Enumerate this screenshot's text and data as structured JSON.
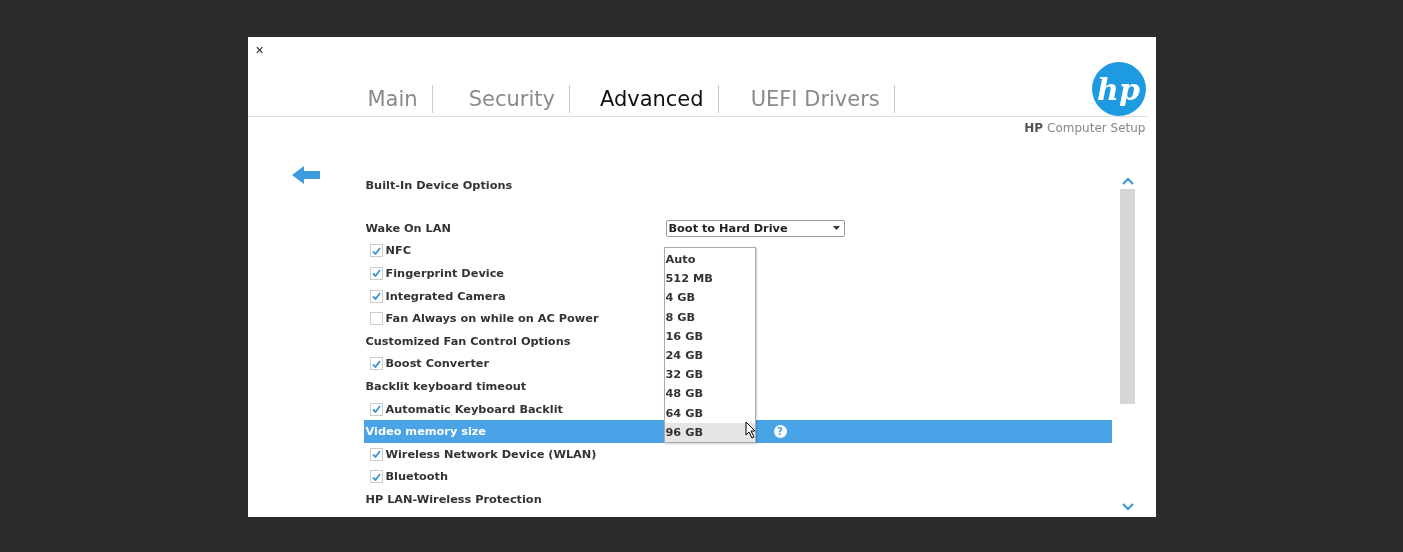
{
  "close": "×",
  "tabs": [
    {
      "label": "Main",
      "selected": false
    },
    {
      "label": "Security",
      "selected": false
    },
    {
      "label": "Advanced",
      "selected": true
    },
    {
      "label": "UEFI Drivers",
      "selected": false
    }
  ],
  "logo": {
    "text": "hp"
  },
  "product": {
    "brand": "HP",
    "name": "Computer Setup"
  },
  "section_title": "Built-In Device Options",
  "help": "?",
  "rows": [
    {
      "kind": "select",
      "label": "Wake On LAN",
      "value": "Boot to Hard Drive",
      "selected": false
    },
    {
      "kind": "checkbox",
      "label": "NFC",
      "checked": true,
      "selected": false
    },
    {
      "kind": "checkbox",
      "label": "Fingerprint Device",
      "checked": true,
      "selected": false
    },
    {
      "kind": "checkbox",
      "label": "Integrated Camera",
      "checked": true,
      "selected": false
    },
    {
      "kind": "checkbox",
      "label": "Fan Always on while on AC Power",
      "checked": false,
      "selected": false
    },
    {
      "kind": "heading",
      "label": "Customized Fan Control Options",
      "selected": false
    },
    {
      "kind": "checkbox",
      "label": "Boost Converter",
      "checked": true,
      "selected": false
    },
    {
      "kind": "heading",
      "label": "Backlit keyboard timeout",
      "selected": false
    },
    {
      "kind": "checkbox",
      "label": "Automatic Keyboard Backlit",
      "checked": true,
      "selected": false
    },
    {
      "kind": "dropdown",
      "label": "Video memory size",
      "selected": true
    },
    {
      "kind": "checkbox",
      "label": "Wireless Network Device (WLAN)",
      "checked": true,
      "selected": false
    },
    {
      "kind": "checkbox",
      "label": "Bluetooth",
      "checked": true,
      "selected": false
    },
    {
      "kind": "heading",
      "label": "HP LAN-Wireless Protection",
      "selected": false
    }
  ],
  "dropdown": {
    "options": [
      {
        "label": "Auto",
        "selected": false
      },
      {
        "label": "512 MB",
        "selected": false
      },
      {
        "label": "4 GB",
        "selected": false
      },
      {
        "label": "8 GB",
        "selected": false
      },
      {
        "label": "16 GB",
        "selected": false
      },
      {
        "label": "24 GB",
        "selected": false
      },
      {
        "label": "32 GB",
        "selected": false
      },
      {
        "label": "48 GB",
        "selected": false
      },
      {
        "label": "64 GB",
        "selected": false
      },
      {
        "label": "96 GB",
        "selected": true
      }
    ]
  }
}
